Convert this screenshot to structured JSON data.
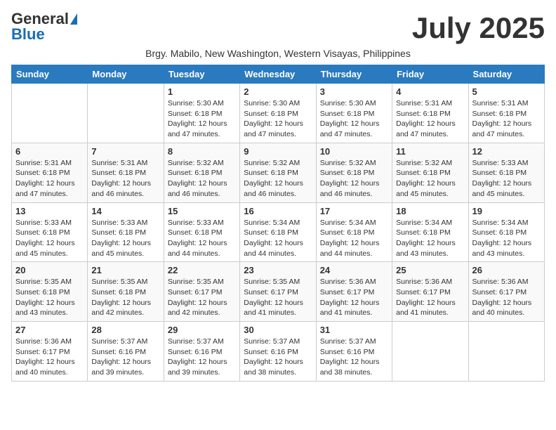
{
  "header": {
    "logo_general": "General",
    "logo_blue": "Blue",
    "month_title": "July 2025",
    "subtitle": "Brgy. Mabilo, New Washington, Western Visayas, Philippines"
  },
  "days_of_week": [
    "Sunday",
    "Monday",
    "Tuesday",
    "Wednesday",
    "Thursday",
    "Friday",
    "Saturday"
  ],
  "weeks": [
    [
      {
        "day": "",
        "info": ""
      },
      {
        "day": "",
        "info": ""
      },
      {
        "day": "1",
        "info": "Sunrise: 5:30 AM\nSunset: 6:18 PM\nDaylight: 12 hours and 47 minutes."
      },
      {
        "day": "2",
        "info": "Sunrise: 5:30 AM\nSunset: 6:18 PM\nDaylight: 12 hours and 47 minutes."
      },
      {
        "day": "3",
        "info": "Sunrise: 5:30 AM\nSunset: 6:18 PM\nDaylight: 12 hours and 47 minutes."
      },
      {
        "day": "4",
        "info": "Sunrise: 5:31 AM\nSunset: 6:18 PM\nDaylight: 12 hours and 47 minutes."
      },
      {
        "day": "5",
        "info": "Sunrise: 5:31 AM\nSunset: 6:18 PM\nDaylight: 12 hours and 47 minutes."
      }
    ],
    [
      {
        "day": "6",
        "info": "Sunrise: 5:31 AM\nSunset: 6:18 PM\nDaylight: 12 hours and 47 minutes."
      },
      {
        "day": "7",
        "info": "Sunrise: 5:31 AM\nSunset: 6:18 PM\nDaylight: 12 hours and 46 minutes."
      },
      {
        "day": "8",
        "info": "Sunrise: 5:32 AM\nSunset: 6:18 PM\nDaylight: 12 hours and 46 minutes."
      },
      {
        "day": "9",
        "info": "Sunrise: 5:32 AM\nSunset: 6:18 PM\nDaylight: 12 hours and 46 minutes."
      },
      {
        "day": "10",
        "info": "Sunrise: 5:32 AM\nSunset: 6:18 PM\nDaylight: 12 hours and 46 minutes."
      },
      {
        "day": "11",
        "info": "Sunrise: 5:32 AM\nSunset: 6:18 PM\nDaylight: 12 hours and 45 minutes."
      },
      {
        "day": "12",
        "info": "Sunrise: 5:33 AM\nSunset: 6:18 PM\nDaylight: 12 hours and 45 minutes."
      }
    ],
    [
      {
        "day": "13",
        "info": "Sunrise: 5:33 AM\nSunset: 6:18 PM\nDaylight: 12 hours and 45 minutes."
      },
      {
        "day": "14",
        "info": "Sunrise: 5:33 AM\nSunset: 6:18 PM\nDaylight: 12 hours and 45 minutes."
      },
      {
        "day": "15",
        "info": "Sunrise: 5:33 AM\nSunset: 6:18 PM\nDaylight: 12 hours and 44 minutes."
      },
      {
        "day": "16",
        "info": "Sunrise: 5:34 AM\nSunset: 6:18 PM\nDaylight: 12 hours and 44 minutes."
      },
      {
        "day": "17",
        "info": "Sunrise: 5:34 AM\nSunset: 6:18 PM\nDaylight: 12 hours and 44 minutes."
      },
      {
        "day": "18",
        "info": "Sunrise: 5:34 AM\nSunset: 6:18 PM\nDaylight: 12 hours and 43 minutes."
      },
      {
        "day": "19",
        "info": "Sunrise: 5:34 AM\nSunset: 6:18 PM\nDaylight: 12 hours and 43 minutes."
      }
    ],
    [
      {
        "day": "20",
        "info": "Sunrise: 5:35 AM\nSunset: 6:18 PM\nDaylight: 12 hours and 43 minutes."
      },
      {
        "day": "21",
        "info": "Sunrise: 5:35 AM\nSunset: 6:18 PM\nDaylight: 12 hours and 42 minutes."
      },
      {
        "day": "22",
        "info": "Sunrise: 5:35 AM\nSunset: 6:17 PM\nDaylight: 12 hours and 42 minutes."
      },
      {
        "day": "23",
        "info": "Sunrise: 5:35 AM\nSunset: 6:17 PM\nDaylight: 12 hours and 41 minutes."
      },
      {
        "day": "24",
        "info": "Sunrise: 5:36 AM\nSunset: 6:17 PM\nDaylight: 12 hours and 41 minutes."
      },
      {
        "day": "25",
        "info": "Sunrise: 5:36 AM\nSunset: 6:17 PM\nDaylight: 12 hours and 41 minutes."
      },
      {
        "day": "26",
        "info": "Sunrise: 5:36 AM\nSunset: 6:17 PM\nDaylight: 12 hours and 40 minutes."
      }
    ],
    [
      {
        "day": "27",
        "info": "Sunrise: 5:36 AM\nSunset: 6:17 PM\nDaylight: 12 hours and 40 minutes."
      },
      {
        "day": "28",
        "info": "Sunrise: 5:37 AM\nSunset: 6:16 PM\nDaylight: 12 hours and 39 minutes."
      },
      {
        "day": "29",
        "info": "Sunrise: 5:37 AM\nSunset: 6:16 PM\nDaylight: 12 hours and 39 minutes."
      },
      {
        "day": "30",
        "info": "Sunrise: 5:37 AM\nSunset: 6:16 PM\nDaylight: 12 hours and 38 minutes."
      },
      {
        "day": "31",
        "info": "Sunrise: 5:37 AM\nSunset: 6:16 PM\nDaylight: 12 hours and 38 minutes."
      },
      {
        "day": "",
        "info": ""
      },
      {
        "day": "",
        "info": ""
      }
    ]
  ]
}
